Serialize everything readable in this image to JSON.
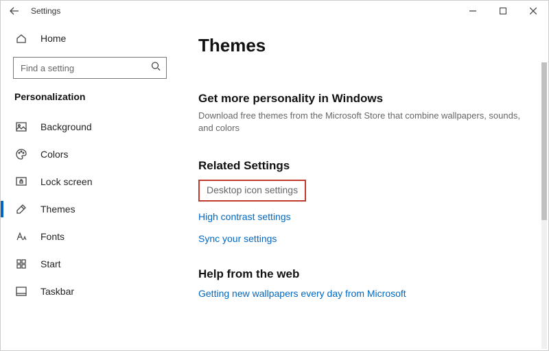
{
  "window": {
    "title": "Settings"
  },
  "sidebar": {
    "home": "Home",
    "search_placeholder": "Find a setting",
    "category": "Personalization",
    "items": [
      {
        "label": "Background"
      },
      {
        "label": "Colors"
      },
      {
        "label": "Lock screen"
      },
      {
        "label": "Themes"
      },
      {
        "label": "Fonts"
      },
      {
        "label": "Start"
      },
      {
        "label": "Taskbar"
      }
    ]
  },
  "main": {
    "title": "Themes",
    "more": {
      "heading": "Get more personality in Windows",
      "body": "Download free themes from the Microsoft Store that combine wallpapers, sounds, and colors"
    },
    "related": {
      "heading": "Related Settings",
      "links": [
        "Desktop icon settings",
        "High contrast settings",
        "Sync your settings"
      ]
    },
    "help": {
      "heading": "Help from the web",
      "link": "Getting new wallpapers every day from Microsoft"
    }
  }
}
